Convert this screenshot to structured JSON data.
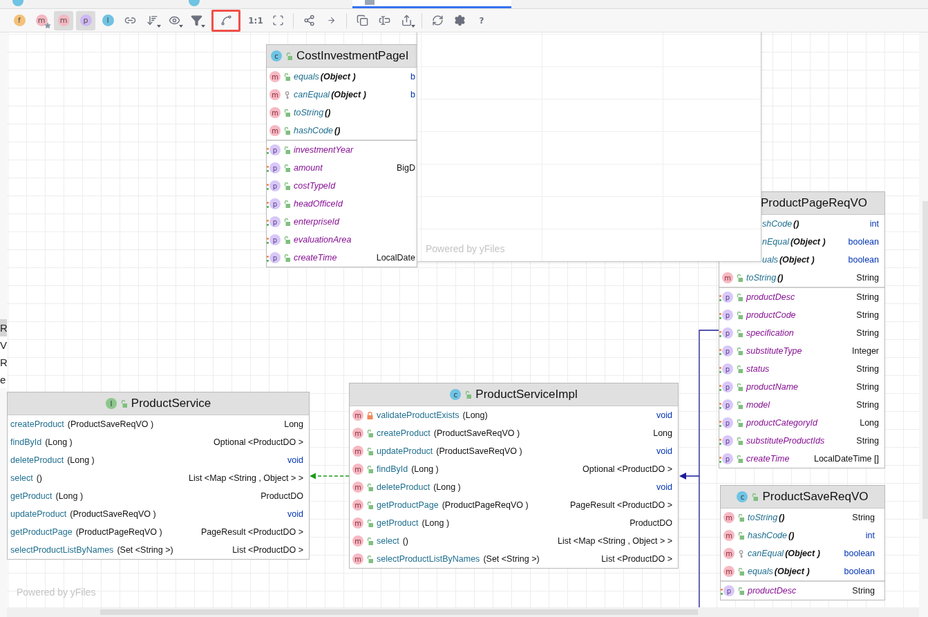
{
  "tabs": [
    {
      "kind": "class",
      "selected": false
    },
    {
      "kind": "class",
      "selected": false
    },
    {
      "kind": "diagram",
      "selected": true
    }
  ],
  "toolbar": [
    {
      "kind": "letter",
      "label": "f",
      "color": "#f3c27a",
      "selected": false,
      "dropdown": false,
      "highlighted": false
    },
    {
      "kind": "letter-star",
      "label": "m",
      "color": "#f4b8c2",
      "selected": false,
      "dropdown": false,
      "highlighted": false
    },
    {
      "kind": "letter",
      "label": "m",
      "color": "#f4b8c2",
      "selected": true,
      "dropdown": false,
      "highlighted": false
    },
    {
      "kind": "letter",
      "label": "p",
      "color": "#cdb9f3",
      "selected": true,
      "dropdown": false,
      "highlighted": false
    },
    {
      "kind": "letter",
      "label": "I",
      "color": "#6fc3e3",
      "selected": false,
      "dropdown": false,
      "highlighted": false
    },
    {
      "kind": "link",
      "selected": false,
      "dropdown": false,
      "highlighted": false
    },
    {
      "kind": "sort",
      "selected": false,
      "dropdown": true,
      "highlighted": false
    },
    {
      "kind": "eye",
      "selected": false,
      "dropdown": true,
      "highlighted": false
    },
    {
      "kind": "filter",
      "selected": false,
      "dropdown": true,
      "highlighted": false
    },
    {
      "kind": "route",
      "selected": false,
      "dropdown": false,
      "highlighted": true
    },
    {
      "kind": "text",
      "label": "1:1",
      "selected": false,
      "dropdown": false,
      "highlighted": false
    },
    {
      "kind": "fit",
      "selected": false,
      "dropdown": false,
      "highlighted": false
    },
    {
      "kind": "separator"
    },
    {
      "kind": "fork",
      "selected": false,
      "dropdown": false,
      "highlighted": false
    },
    {
      "kind": "arrow",
      "selected": false,
      "dropdown": false,
      "highlighted": false
    },
    {
      "kind": "separator"
    },
    {
      "kind": "copy",
      "selected": false,
      "dropdown": false,
      "highlighted": false
    },
    {
      "kind": "format",
      "selected": false,
      "dropdown": false,
      "highlighted": false
    },
    {
      "kind": "export",
      "selected": false,
      "dropdown": true,
      "highlighted": false
    },
    {
      "kind": "separator"
    },
    {
      "kind": "refresh",
      "selected": false,
      "dropdown": false,
      "highlighted": false
    },
    {
      "kind": "settings",
      "selected": false,
      "dropdown": false,
      "highlighted": false
    },
    {
      "kind": "text",
      "label": "?",
      "selected": false,
      "dropdown": false,
      "highlighted": false
    }
  ],
  "left_panel": {
    "letters": [
      {
        "text": "R",
        "selected": true
      },
      {
        "text": "V",
        "selected": false
      },
      {
        "text": "R",
        "selected": false
      },
      {
        "text": "e",
        "selected": false
      }
    ]
  },
  "canvas": {
    "watermark": "Powered by yFiles",
    "nodes": [
      {
        "title": "CostInvestmentPageI",
        "badge": "c",
        "methods": [
          {
            "badge": "m",
            "kind": "public",
            "generated": true,
            "name": "equals",
            "params": "(Object )",
            "type": "b",
            "keyword_type": true
          },
          {
            "badge": "m",
            "kind": "package",
            "generated": true,
            "name": "canEqual",
            "params": "(Object )",
            "type": "b",
            "keyword_type": true
          },
          {
            "badge": "m",
            "kind": "public",
            "generated": true,
            "name": "toString",
            "params": "()"
          },
          {
            "badge": "m",
            "kind": "public",
            "generated": true,
            "name": "hashCode",
            "params": "()"
          }
        ],
        "fields": [
          {
            "badge": "p",
            "kind": "public",
            "name": "investmentYear"
          },
          {
            "badge": "p",
            "kind": "public",
            "name": "amount",
            "type": "BigD",
            "keyword_type": false
          },
          {
            "badge": "p",
            "kind": "public",
            "name": "costTypeId"
          },
          {
            "badge": "p",
            "kind": "public",
            "name": "headOfficeId"
          },
          {
            "badge": "p",
            "kind": "public",
            "name": "enterpriseId"
          },
          {
            "badge": "p",
            "kind": "public",
            "name": "evaluationArea"
          },
          {
            "badge": "p",
            "kind": "public",
            "name": "createTime",
            "type": "LocalDate",
            "keyword_type": false
          }
        ]
      },
      {
        "title": "ProductPageReqVO",
        "methods": [
          {
            "clipped": true,
            "generated": true,
            "name": "shCode",
            "params": "()",
            "type": "int",
            "keyword_type": true
          },
          {
            "clipped": true,
            "generated": true,
            "name": "nEqual",
            "params": "(Object )",
            "type": "boolean",
            "keyword_type": true
          },
          {
            "clipped": true,
            "generated": true,
            "name": "uals",
            "params": "(Object )",
            "type": "boolean",
            "keyword_type": true
          },
          {
            "badge": "m",
            "kind": "public",
            "generated": true,
            "name": "toString",
            "params": "()",
            "type": "String",
            "keyword_type": false
          }
        ],
        "fields": [
          {
            "badge": "p",
            "kind": "public",
            "name": "productDesc",
            "type": "String",
            "keyword_type": false
          },
          {
            "badge": "p",
            "kind": "public",
            "name": "productCode",
            "type": "String",
            "keyword_type": false
          },
          {
            "badge": "p",
            "kind": "public",
            "name": "specification",
            "type": "String",
            "keyword_type": false
          },
          {
            "badge": "p",
            "kind": "public",
            "name": "substituteType",
            "type": "Integer",
            "keyword_type": false
          },
          {
            "badge": "p",
            "kind": "public",
            "name": "status",
            "type": "String",
            "keyword_type": false
          },
          {
            "badge": "p",
            "kind": "public",
            "name": "productName",
            "type": "String",
            "keyword_type": false
          },
          {
            "badge": "p",
            "kind": "public",
            "name": "model",
            "type": "String",
            "keyword_type": false
          },
          {
            "badge": "p",
            "kind": "public",
            "name": "productCategoryId",
            "type": "Long",
            "keyword_type": false
          },
          {
            "badge": "p",
            "kind": "public",
            "name": "substituteProductIds",
            "type": "String",
            "keyword_type": false
          },
          {
            "badge": "p",
            "kind": "public",
            "name": "createTime",
            "type": "LocalDateTime []",
            "keyword_type": false
          }
        ]
      },
      {
        "title": "ProductService",
        "badge": "I",
        "methods": [
          {
            "generated": false,
            "name": "createProduct",
            "params": "(ProductSaveReqVO )",
            "type": "Long",
            "keyword_type": false
          },
          {
            "generated": false,
            "name": "findById",
            "params": "(Long )",
            "type": "Optional <ProductDO >",
            "keyword_type": false
          },
          {
            "generated": false,
            "name": "deleteProduct",
            "params": "(Long )",
            "type": "void",
            "keyword_type": true
          },
          {
            "generated": false,
            "name": "select",
            "params": "()",
            "type": "List <Map <String , Object > >",
            "keyword_type": false
          },
          {
            "generated": false,
            "name": "getProduct",
            "params": "(Long )",
            "type": "ProductDO",
            "keyword_type": false
          },
          {
            "generated": false,
            "name": "updateProduct",
            "params": "(ProductSaveReqVO )",
            "type": "void",
            "keyword_type": true
          },
          {
            "generated": false,
            "name": "getProductPage",
            "params": "(ProductPageReqVO )",
            "type": "PageResult <ProductDO >",
            "keyword_type": false
          },
          {
            "generated": false,
            "name": "selectProductListByNames",
            "params": "(Set <String >)",
            "type": "List <ProductDO >",
            "keyword_type": false
          }
        ]
      },
      {
        "title": "ProductServiceImpl",
        "badge": "c",
        "methods": [
          {
            "badge": "m",
            "kind": "private",
            "generated": false,
            "name": "validateProductExists",
            "params": "(Long)",
            "type": "void",
            "keyword_type": true
          },
          {
            "badge": "m",
            "kind": "public",
            "generated": false,
            "name": "createProduct",
            "params": "(ProductSaveReqVO )",
            "type": "Long",
            "keyword_type": false
          },
          {
            "badge": "m",
            "kind": "public",
            "generated": false,
            "name": "updateProduct",
            "params": "(ProductSaveReqVO )",
            "type": "void",
            "keyword_type": true
          },
          {
            "badge": "m",
            "kind": "public",
            "generated": false,
            "name": "findById",
            "params": "(Long )",
            "type": "Optional <ProductDO >",
            "keyword_type": false
          },
          {
            "badge": "m",
            "kind": "public",
            "generated": false,
            "name": "deleteProduct",
            "params": "(Long )",
            "type": "void",
            "keyword_type": true
          },
          {
            "badge": "m",
            "kind": "public",
            "generated": false,
            "name": "getProductPage",
            "params": "(ProductPageReqVO )",
            "type": "PageResult <ProductDO >",
            "keyword_type": false
          },
          {
            "badge": "m",
            "kind": "public",
            "generated": false,
            "name": "getProduct",
            "params": "(Long )",
            "type": "ProductDO",
            "keyword_type": false
          },
          {
            "badge": "m",
            "kind": "public",
            "generated": false,
            "name": "select",
            "params": "()",
            "type": "List <Map <String , Object > >",
            "keyword_type": false
          },
          {
            "badge": "m",
            "kind": "public",
            "generated": false,
            "name": "selectProductListByNames",
            "params": "(Set <String >)",
            "type": "List <ProductDO >",
            "keyword_type": false
          }
        ]
      },
      {
        "title": "ProductSaveReqVO",
        "badge": "c",
        "methods": [
          {
            "badge": "m",
            "kind": "public",
            "generated": true,
            "name": "toString",
            "params": "()",
            "type": "String",
            "keyword_type": false
          },
          {
            "badge": "m",
            "kind": "public",
            "generated": true,
            "name": "hashCode",
            "params": "()",
            "type": "int",
            "keyword_type": true
          },
          {
            "badge": "m",
            "kind": "package",
            "generated": true,
            "name": "canEqual",
            "params": "(Object )",
            "type": "boolean",
            "keyword_type": true
          },
          {
            "badge": "m",
            "kind": "public",
            "generated": true,
            "name": "equals",
            "params": "(Object )",
            "type": "boolean",
            "keyword_type": true
          }
        ],
        "fields": [
          {
            "badge": "p",
            "kind": "public",
            "name": "productDesc",
            "type": "String",
            "keyword_type": false
          }
        ]
      }
    ],
    "edges": [
      {
        "kind": "realization"
      },
      {
        "kind": "association"
      }
    ]
  },
  "preview": {
    "watermark": "Powered by yFiles"
  }
}
